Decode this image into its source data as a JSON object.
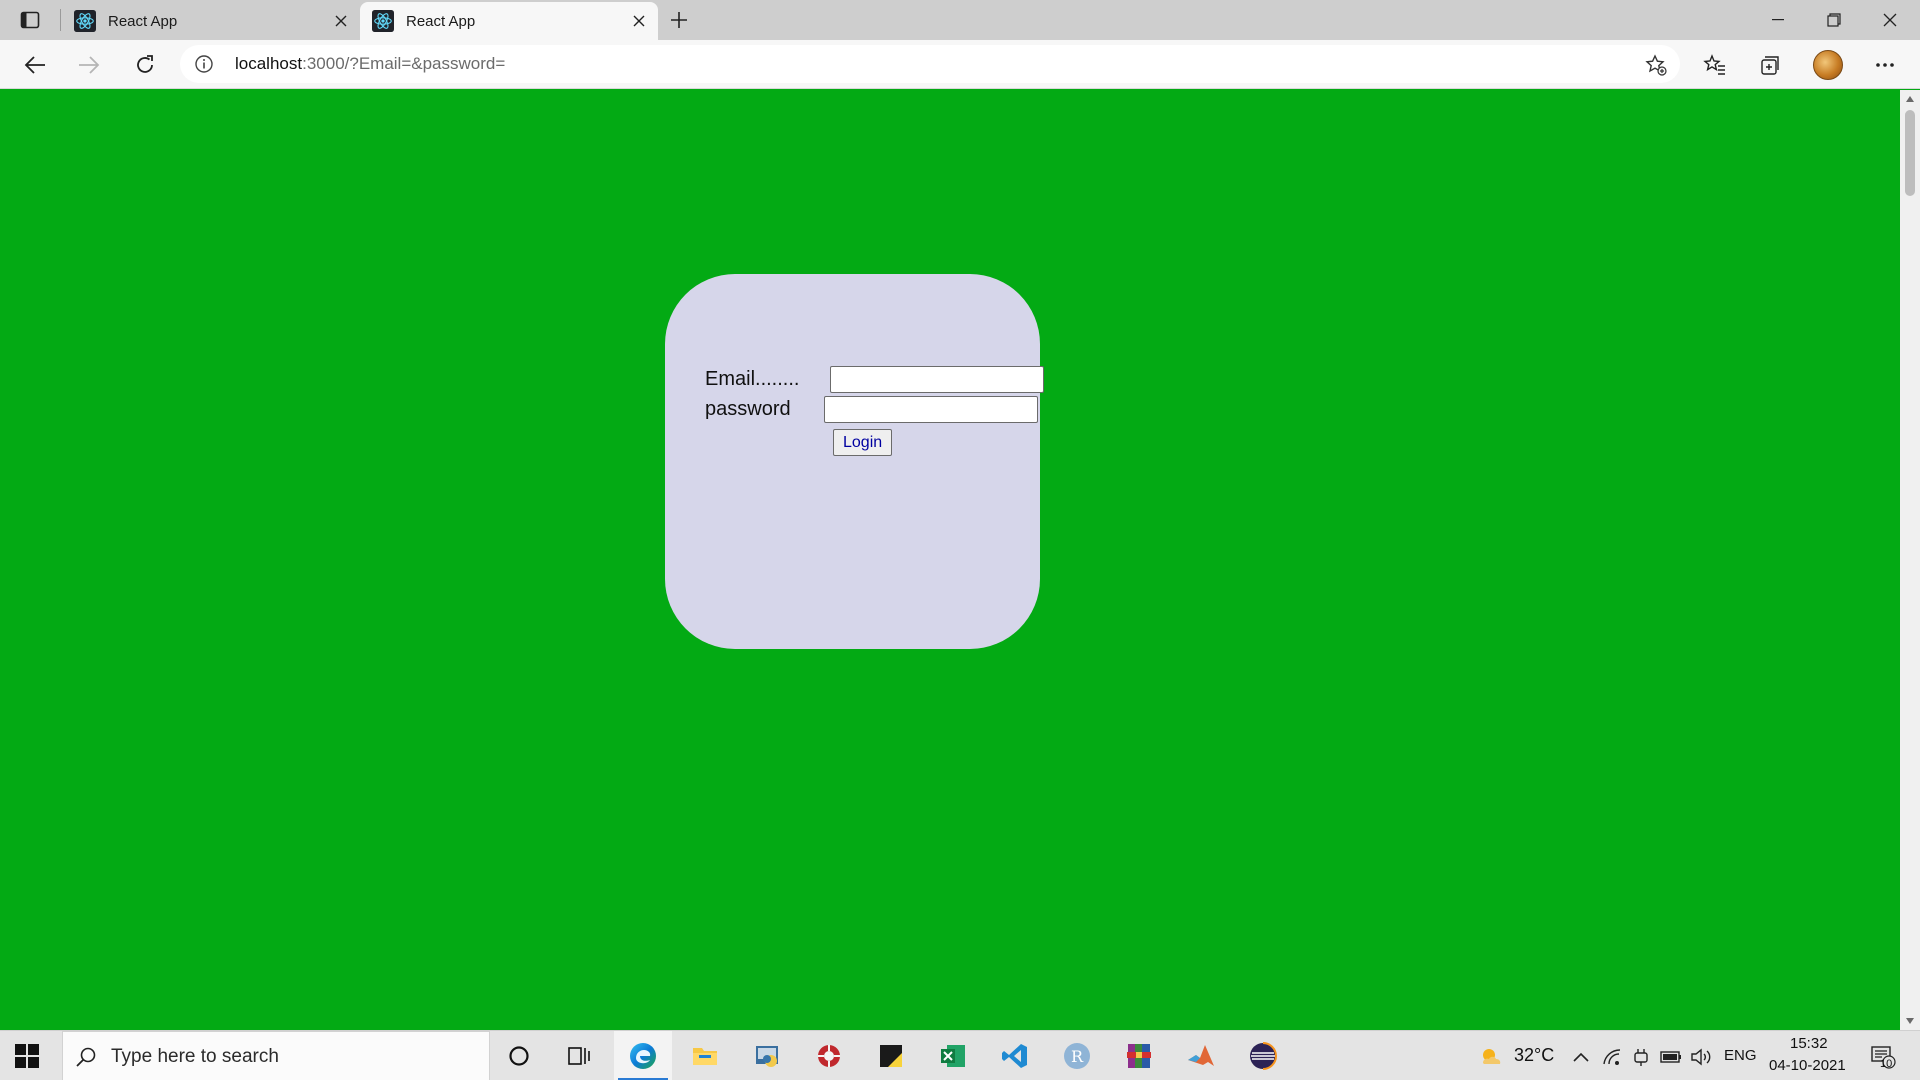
{
  "browser": {
    "tabs": [
      {
        "title": "React App",
        "active": false
      },
      {
        "title": "React App",
        "active": true
      }
    ],
    "address": {
      "host": "localhost",
      "rest": ":3000/?Email=&password="
    }
  },
  "form": {
    "email_label": "Email........",
    "password_label": "password",
    "email_value": "",
    "password_value": "",
    "login_label": "Login"
  },
  "colors": {
    "page_background": "#03aa14",
    "card_background": "#d6d6ea"
  },
  "taskbar": {
    "search_placeholder": "Type here to search",
    "apps": [
      "cortana-icon",
      "task-view-icon",
      "edge-icon",
      "file-explorer-icon",
      "python-icon",
      "app-red-icon",
      "sticky-notes-icon",
      "excel-icon",
      "vscode-icon",
      "r-icon",
      "winrar-icon",
      "matlab-icon",
      "eclipse-icon"
    ],
    "weather": "32°C",
    "language": "ENG",
    "time": "15:32",
    "date": "04-10-2021",
    "notification_count": "10"
  }
}
